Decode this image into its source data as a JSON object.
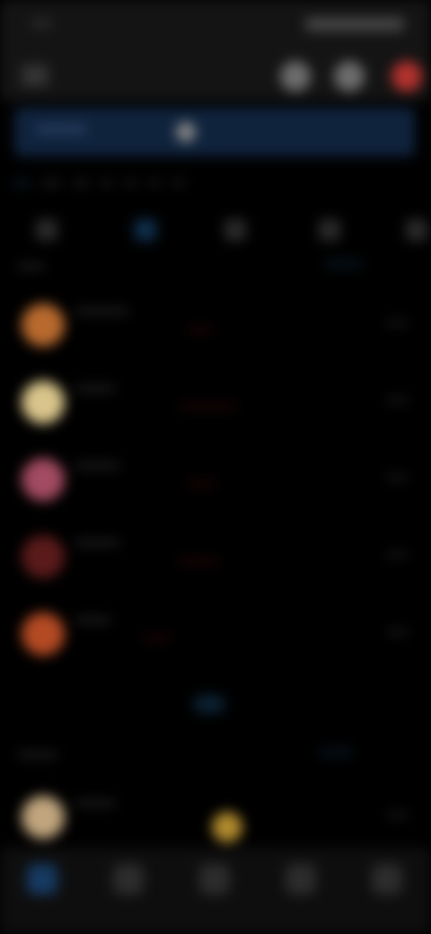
{
  "status_bar": {
    "time": "••••"
  },
  "header": {
    "title": ""
  },
  "banner": {
    "text": "••••••••••"
  },
  "nav": {
    "chips": [
      "••••",
      "•••••",
      "••••",
      "•••",
      "•••",
      "•••",
      "•••"
    ]
  },
  "section1": {
    "title": "••••••",
    "link": "•••••••••"
  },
  "section2": {
    "title": "•••••••••",
    "link": "••••••••"
  },
  "rows": [
    {
      "name": "••••••••••••",
      "sub": "",
      "tag": "•••••••",
      "value": "•••••",
      "avatar_color": "#b86a2e"
    },
    {
      "name": "•••••••••",
      "sub": "",
      "tag": "•••••••••••••••",
      "value": "•••••",
      "avatar_color": "#d9c58b"
    },
    {
      "name": "••••••••••",
      "sub": "",
      "tag": "•••••••",
      "value": "•••••",
      "avatar_color": "#a24b61"
    },
    {
      "name": "••••••••••",
      "sub": "",
      "tag": "•••••••••••",
      "value": "•••••",
      "avatar_color": "#5a1a1a"
    },
    {
      "name": "••••••••",
      "sub": "",
      "tag": "•••••••",
      "value": "•••••",
      "avatar_color": "#b34a24"
    }
  ],
  "footer_row": {
    "name": "•••••••••",
    "value": "•••••",
    "avatar_color": "#c0a57e",
    "badge_color": "#b08a2e"
  },
  "bottom_nav": {
    "items": [
      "home",
      "explore",
      "add",
      "messages",
      "profile"
    ]
  }
}
